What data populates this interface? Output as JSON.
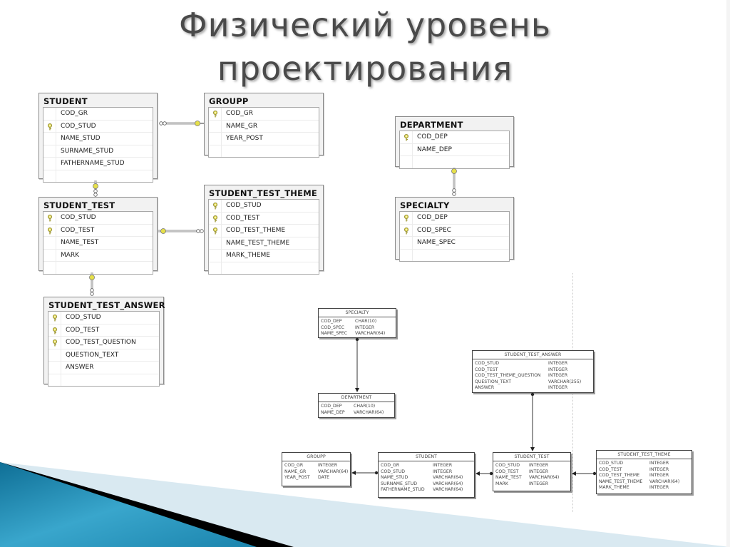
{
  "slide": {
    "title_line1": "Физический уровень",
    "title_line2": "проектирования"
  },
  "colors": {
    "accent_blue": "#1f88b0",
    "wedge_black": "#000000",
    "wedge_light": "#d9e9f1",
    "key_yellow": "#d8d04a",
    "title_gray": "#4a4a4a"
  },
  "ssms_diagram": {
    "tables": {
      "student": {
        "name": "STUDENT",
        "fields": [
          {
            "name": "COD_GR",
            "pk": false
          },
          {
            "name": "COD_STUD",
            "pk": true
          },
          {
            "name": "NAME_STUD",
            "pk": false
          },
          {
            "name": "SURNAME_STUD",
            "pk": false
          },
          {
            "name": "FATHERNAME_STUD",
            "pk": false
          }
        ]
      },
      "groupp": {
        "name": "GROUPP",
        "fields": [
          {
            "name": "COD_GR",
            "pk": true
          },
          {
            "name": "NAME_GR",
            "pk": false
          },
          {
            "name": "YEAR_POST",
            "pk": false
          }
        ]
      },
      "student_test": {
        "name": "STUDENT_TEST",
        "fields": [
          {
            "name": "COD_STUD",
            "pk": true
          },
          {
            "name": "COD_TEST",
            "pk": true
          },
          {
            "name": "NAME_TEST",
            "pk": false
          },
          {
            "name": "MARK",
            "pk": false
          }
        ]
      },
      "student_test_theme": {
        "name": "STUDENT_TEST_THEME",
        "fields": [
          {
            "name": "COD_STUD",
            "pk": true
          },
          {
            "name": "COD_TEST",
            "pk": true
          },
          {
            "name": "COD_TEST_THEME",
            "pk": true
          },
          {
            "name": "NAME_TEST_THEME",
            "pk": false
          },
          {
            "name": "MARK_THEME",
            "pk": false
          }
        ]
      },
      "student_test_answer": {
        "name": "STUDENT_TEST_ANSWER",
        "fields": [
          {
            "name": "COD_STUD",
            "pk": true
          },
          {
            "name": "COD_TEST",
            "pk": true
          },
          {
            "name": "COD_TEST_QUESTION",
            "pk": true
          },
          {
            "name": "QUESTION_TEXT",
            "pk": false
          },
          {
            "name": "ANSWER",
            "pk": false
          }
        ]
      },
      "department": {
        "name": "DEPARTMENT",
        "fields": [
          {
            "name": "COD_DEP",
            "pk": true
          },
          {
            "name": "NAME_DEP",
            "pk": false
          }
        ]
      },
      "specialty": {
        "name": "SPECIALTY",
        "fields": [
          {
            "name": "COD_DEP",
            "pk": true
          },
          {
            "name": "COD_SPEC",
            "pk": true
          },
          {
            "name": "NAME_SPEC",
            "pk": false
          }
        ]
      }
    },
    "relationships": [
      {
        "from": "STUDENT",
        "to": "GROUPP",
        "type": "many-to-one"
      },
      {
        "from": "STUDENT_TEST",
        "to": "STUDENT",
        "type": "many-to-one"
      },
      {
        "from": "STUDENT_TEST_THEME",
        "to": "STUDENT_TEST",
        "type": "many-to-one"
      },
      {
        "from": "STUDENT_TEST_ANSWER",
        "to": "STUDENT_TEST",
        "type": "many-to-one"
      },
      {
        "from": "SPECIALTY",
        "to": "DEPARTMENT",
        "type": "many-to-one"
      }
    ]
  },
  "erwin_diagram": {
    "tables": {
      "specialty": {
        "name": "SPECIALTY",
        "columns": [
          {
            "name": "COD_DEP",
            "type": "CHAR(10)"
          },
          {
            "name": "COD_SPEC",
            "type": "INTEGER"
          },
          {
            "name": "NAME_SPEC",
            "type": "VARCHAR(64)"
          }
        ]
      },
      "department": {
        "name": "DEPARTMENT",
        "columns": [
          {
            "name": "COD_DEP",
            "type": "CHAR(10)"
          },
          {
            "name": "NAME_DEP",
            "type": "VARCHAR(64)"
          }
        ]
      },
      "student_test_answer": {
        "name": "STUDENT_TEST_ANSWER",
        "columns": [
          {
            "name": "COD_STUD",
            "type": "INTEGER"
          },
          {
            "name": "COD_TEST",
            "type": "INTEGER"
          },
          {
            "name": "COD_TEST_THEME_QUESTION",
            "type": "INTEGER"
          },
          {
            "name": "QUESTION_TEXT",
            "type": "VARCHAR(255)"
          },
          {
            "name": "ANSWER",
            "type": "INTEGER"
          }
        ]
      },
      "groupp": {
        "name": "GROUPP",
        "columns": [
          {
            "name": "COD_GR",
            "type": "INTEGER"
          },
          {
            "name": "NAME_GR",
            "type": "VARCHAR(64)"
          },
          {
            "name": "YEAR_POST",
            "type": "DATE"
          }
        ]
      },
      "student": {
        "name": "STUDENT",
        "columns": [
          {
            "name": "COD_GR",
            "type": "INTEGER"
          },
          {
            "name": "COD_STUD",
            "type": "INTEGER"
          },
          {
            "name": "NAME_STUD",
            "type": "VARCHAR(64)"
          },
          {
            "name": "SURNAME_STUD",
            "type": "VARCHAR(64)"
          },
          {
            "name": "FATHERNAME_STUD",
            "type": "VARCHAR(64)"
          }
        ]
      },
      "student_test": {
        "name": "STUDENT_TEST",
        "columns": [
          {
            "name": "COD_STUD",
            "type": "INTEGER"
          },
          {
            "name": "COD_TEST",
            "type": "INTEGER"
          },
          {
            "name": "NAME_TEST",
            "type": "VARCHAR(64)"
          },
          {
            "name": "MARK",
            "type": "INTEGER"
          }
        ]
      },
      "student_test_theme": {
        "name": "STUDENT_TEST_THEME",
        "columns": [
          {
            "name": "COD_STUD",
            "type": "INTEGER"
          },
          {
            "name": "COD_TEST",
            "type": "INTEGER"
          },
          {
            "name": "COD_TEST_THEME",
            "type": "INTEGER"
          },
          {
            "name": "NAME_TEST_THEME",
            "type": "VARCHAR(64)"
          },
          {
            "name": "MARK_THEME",
            "type": "INTEGER"
          }
        ]
      }
    },
    "relationships": [
      {
        "from": "SPECIALTY",
        "to": "DEPARTMENT"
      },
      {
        "from": "STUDENT",
        "to": "GROUPP"
      },
      {
        "from": "STUDENT_TEST",
        "to": "STUDENT"
      },
      {
        "from": "STUDENT_TEST_ANSWER",
        "to": "STUDENT_TEST"
      },
      {
        "from": "STUDENT_TEST_THEME",
        "to": "STUDENT_TEST"
      }
    ]
  }
}
